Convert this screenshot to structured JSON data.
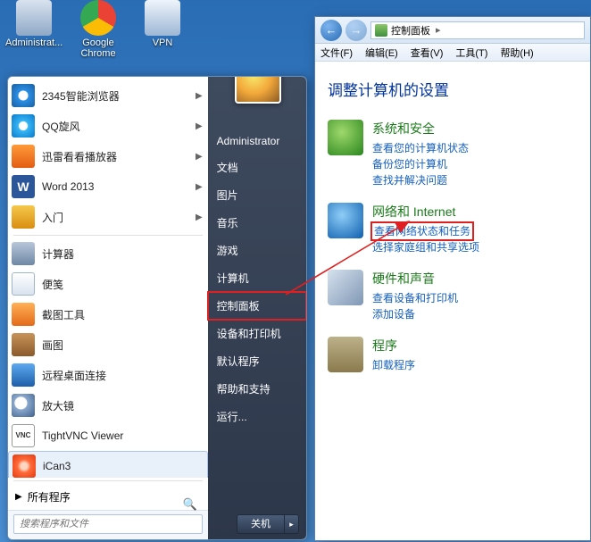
{
  "desktop_icons": {
    "admin": "Administrat...",
    "chrome": "Google Chrome",
    "vpn": "VPN"
  },
  "start_menu": {
    "items": [
      {
        "label": "2345智能浏览器",
        "icon": "ic-ie",
        "arrow": true
      },
      {
        "label": "QQ旋风",
        "icon": "ic-qq",
        "arrow": true
      },
      {
        "label": "迅雷看看播放器",
        "icon": "ic-xl",
        "arrow": true
      },
      {
        "label": "Word 2013",
        "icon": "ic-word",
        "arrow": true
      },
      {
        "label": "入门",
        "icon": "ic-intro",
        "arrow": true
      },
      {
        "label": "计算器",
        "icon": "ic-comp",
        "arrow": false
      },
      {
        "label": "便笺",
        "icon": "ic-note",
        "arrow": false
      },
      {
        "label": "截图工具",
        "icon": "ic-snip",
        "arrow": false
      },
      {
        "label": "画图",
        "icon": "ic-paint",
        "arrow": false
      },
      {
        "label": "远程桌面连接",
        "icon": "ic-rdp",
        "arrow": false
      },
      {
        "label": "放大镜",
        "icon": "ic-mag",
        "arrow": false
      },
      {
        "label": "TightVNC Viewer",
        "icon": "ic-vnc",
        "arrow": false
      },
      {
        "label": "iCan3",
        "icon": "ic-ican",
        "arrow": false,
        "hover": true
      }
    ],
    "all_programs": "所有程序",
    "search_placeholder": "搜索程序和文件",
    "right": {
      "user": "Administrator",
      "links": [
        "文档",
        "图片",
        "音乐",
        "游戏",
        "计算机",
        "控制面板",
        "设备和打印机",
        "默认程序",
        "帮助和支持",
        "运行..."
      ],
      "highlighted_index": 5,
      "shutdown": "关机"
    }
  },
  "control_panel": {
    "address": "控制面板",
    "menubar": [
      "文件(F)",
      "编辑(E)",
      "查看(V)",
      "工具(T)",
      "帮助(H)"
    ],
    "heading": "调整计算机的设置",
    "categories": [
      {
        "title": "系统和安全",
        "icon": "cat-sec",
        "links": [
          "查看您的计算机状态",
          "备份您的计算机",
          "查找并解决问题"
        ]
      },
      {
        "title": "网络和 Internet",
        "icon": "cat-net",
        "links": [
          "查看网络状态和任务",
          "选择家庭组和共享选项"
        ],
        "boxed_link_index": 0
      },
      {
        "title": "硬件和声音",
        "icon": "cat-hw",
        "links": [
          "查看设备和打印机",
          "添加设备"
        ]
      },
      {
        "title": "程序",
        "icon": "cat-prog",
        "links": [
          "卸载程序"
        ]
      }
    ]
  }
}
